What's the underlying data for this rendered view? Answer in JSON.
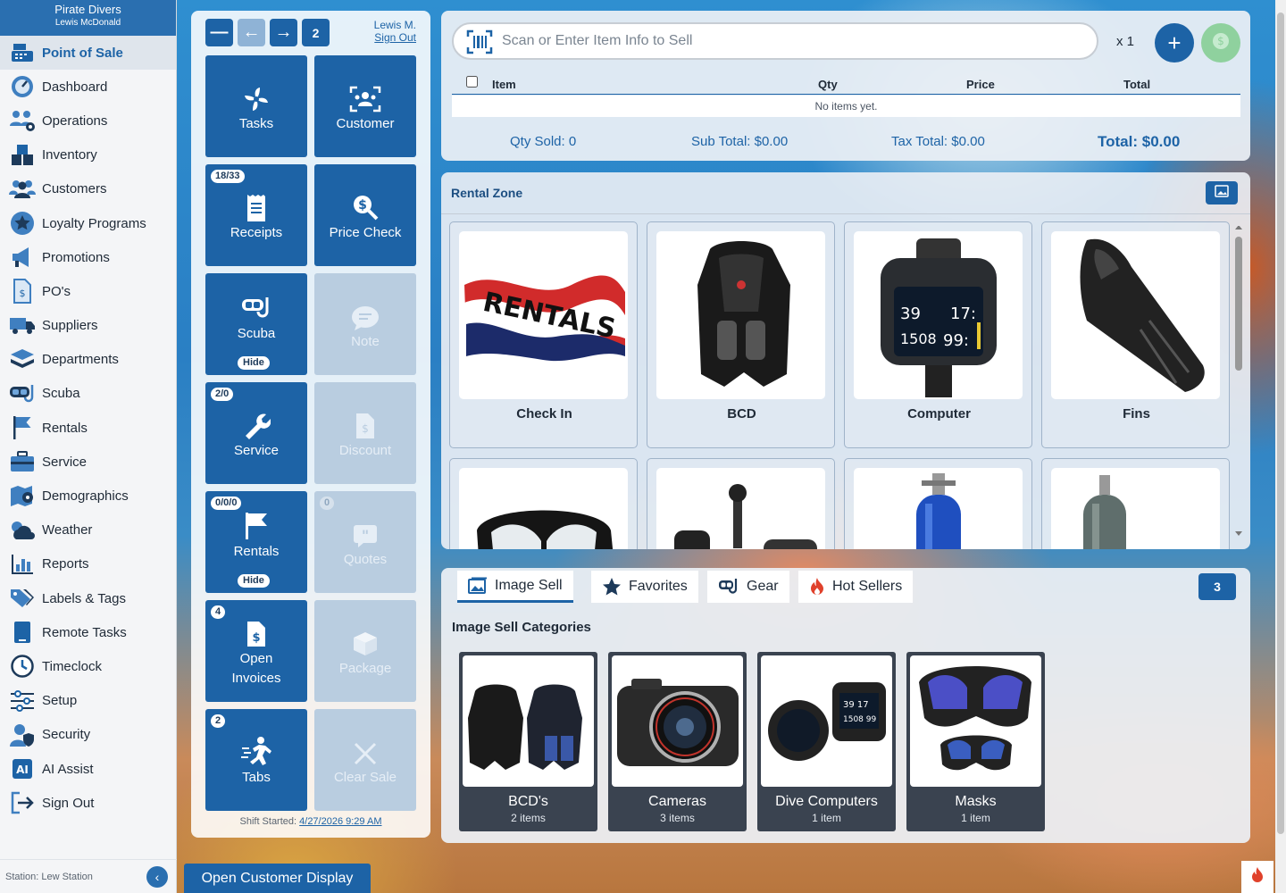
{
  "brand": {
    "org": "Pirate Divers",
    "user": "Lewis McDonald"
  },
  "sidebar": {
    "items": [
      {
        "label": "Point of Sale",
        "icon": "cash-register-icon"
      },
      {
        "label": "Dashboard",
        "icon": "dashboard-icon"
      },
      {
        "label": "Operations",
        "icon": "operations-icon"
      },
      {
        "label": "Inventory",
        "icon": "inventory-icon"
      },
      {
        "label": "Customers",
        "icon": "customers-icon"
      },
      {
        "label": "Loyalty Programs",
        "icon": "loyalty-icon"
      },
      {
        "label": "Promotions",
        "icon": "megaphone-icon"
      },
      {
        "label": "PO's",
        "icon": "po-icon"
      },
      {
        "label": "Suppliers",
        "icon": "truck-icon"
      },
      {
        "label": "Departments",
        "icon": "layers-icon"
      },
      {
        "label": "Scuba",
        "icon": "mask-icon"
      },
      {
        "label": "Rentals",
        "icon": "flag-icon"
      },
      {
        "label": "Service",
        "icon": "toolbox-icon"
      },
      {
        "label": "Demographics",
        "icon": "map-icon"
      },
      {
        "label": "Weather",
        "icon": "weather-icon"
      },
      {
        "label": "Reports",
        "icon": "chart-icon"
      },
      {
        "label": "Labels & Tags",
        "icon": "tag-icon"
      },
      {
        "label": "Remote Tasks",
        "icon": "tablet-icon"
      },
      {
        "label": "Timeclock",
        "icon": "clock-icon"
      },
      {
        "label": "Setup",
        "icon": "sliders-icon"
      },
      {
        "label": "Security",
        "icon": "security-icon"
      },
      {
        "label": "AI Assist",
        "icon": "ai-icon"
      },
      {
        "label": "Sign Out",
        "icon": "sign-out-icon"
      }
    ],
    "station": "Station: Lew Station"
  },
  "tiles": {
    "page": "2",
    "user_name": "Lewis M.",
    "sign_out": "Sign Out",
    "items": [
      {
        "label": "Tasks",
        "badge": "",
        "hide": ""
      },
      {
        "label": "Customer",
        "badge": "",
        "hide": ""
      },
      {
        "label": "Receipts",
        "badge": "18/33",
        "hide": ""
      },
      {
        "label": "Price Check",
        "badge": "",
        "hide": ""
      },
      {
        "label": "Scuba",
        "badge": "",
        "hide": "Hide"
      },
      {
        "label": "Note",
        "badge": "",
        "hide": ""
      },
      {
        "label": "Service",
        "badge": "2/0",
        "hide": ""
      },
      {
        "label": "Discount",
        "badge": "",
        "hide": ""
      },
      {
        "label": "Rentals",
        "badge": "0/0/0",
        "hide": "Hide"
      },
      {
        "label": "Quotes",
        "badge": "0",
        "hide": ""
      },
      {
        "label": "Open Invoices",
        "badge": "4",
        "hide": ""
      },
      {
        "label": "Package",
        "badge": "",
        "hide": ""
      },
      {
        "label": "Tabs",
        "badge": "2",
        "hide": ""
      },
      {
        "label": "Clear Sale",
        "badge": "",
        "hide": ""
      }
    ],
    "shift_label": "Shift Started:",
    "shift_time": "4/27/2026 9:29 AM"
  },
  "sale": {
    "scan_placeholder": "Scan or Enter Item Info to Sell",
    "qty_multiplier": "x 1",
    "columns": {
      "item": "Item",
      "qty": "Qty",
      "price": "Price",
      "total": "Total"
    },
    "empty": "No items yet.",
    "qty_sold_label": "Qty Sold:",
    "qty_sold": "0",
    "subtotal_label": "Sub Total:",
    "subtotal": "$0.00",
    "tax_label": "Tax Total:",
    "tax": "$0.00",
    "total_label": "Total:",
    "total": "$0.00",
    "colors": {
      "accent": "#1d63a6",
      "pay": "#8fd19e"
    }
  },
  "rental_zone": {
    "title": "Rental Zone",
    "cards": [
      {
        "label": "Check In",
        "image": "rentals-flag"
      },
      {
        "label": "BCD",
        "image": "bcd-vest"
      },
      {
        "label": "Computer",
        "image": "dive-computer"
      },
      {
        "label": "Fins",
        "image": "fin"
      },
      {
        "label": "",
        "image": "mask"
      },
      {
        "label": "",
        "image": "regulator"
      },
      {
        "label": "",
        "image": "blue-tank"
      },
      {
        "label": "",
        "image": "gray-tank"
      }
    ]
  },
  "tabs": {
    "items": [
      {
        "label": "Image Sell",
        "icon": "image-icon",
        "active": true
      },
      {
        "label": "Favorites",
        "icon": "star-icon",
        "active": false
      },
      {
        "label": "Gear",
        "icon": "mask-icon",
        "active": false
      },
      {
        "label": "Hot Sellers",
        "icon": "fire-icon",
        "active": false
      }
    ],
    "count": "3",
    "categories_title": "Image Sell Categories",
    "categories": [
      {
        "name": "BCD's",
        "count": "2 items"
      },
      {
        "name": "Cameras",
        "count": "3 items"
      },
      {
        "name": "Dive Computers",
        "count": "1 item"
      },
      {
        "name": "Masks",
        "count": "1 item"
      }
    ]
  },
  "footer": {
    "customer_display": "Open Customer Display"
  }
}
